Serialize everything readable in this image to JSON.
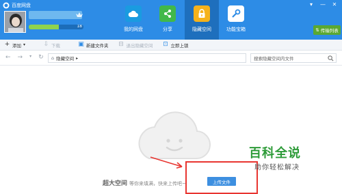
{
  "app": {
    "title": "百度网盘"
  },
  "window_controls": [
    "▾",
    "—",
    "✕"
  ],
  "user": {
    "quota_text": "18",
    "quota_fraction": 0.55
  },
  "nav": [
    {
      "label": "我的网盘",
      "icon": "cloud-icon",
      "color": "#1a9be0"
    },
    {
      "label": "分享",
      "icon": "share-icon",
      "color": "#41b84a"
    },
    {
      "label": "隐藏空间",
      "icon": "lock-icon",
      "color": "#f5b21b",
      "active": true
    },
    {
      "label": "功能宝箱",
      "icon": "tools-icon",
      "color": "#2d8ce6"
    }
  ],
  "transfer": {
    "label": "传输列表"
  },
  "toolbar": {
    "add": "添加",
    "download": "下载",
    "new_folder": "新建文件夹",
    "exit_hidden": "退出隐藏空间",
    "lock_now": "立即上锁"
  },
  "address": {
    "path": "隐藏空间",
    "search_placeholder": "搜索隐藏空间内文件"
  },
  "empty": {
    "title": "超大空间",
    "subtitle": "等你来填满，快来上传吧~",
    "upload_button": "上传文件"
  },
  "watermark": {
    "title": "百科全说",
    "subtitle": "助你轻松解决"
  },
  "colors": {
    "header": "#2d8ce6",
    "active_tab": "#1e6fbd",
    "transfer": "#5aa831",
    "annotation": "#e8342f"
  }
}
